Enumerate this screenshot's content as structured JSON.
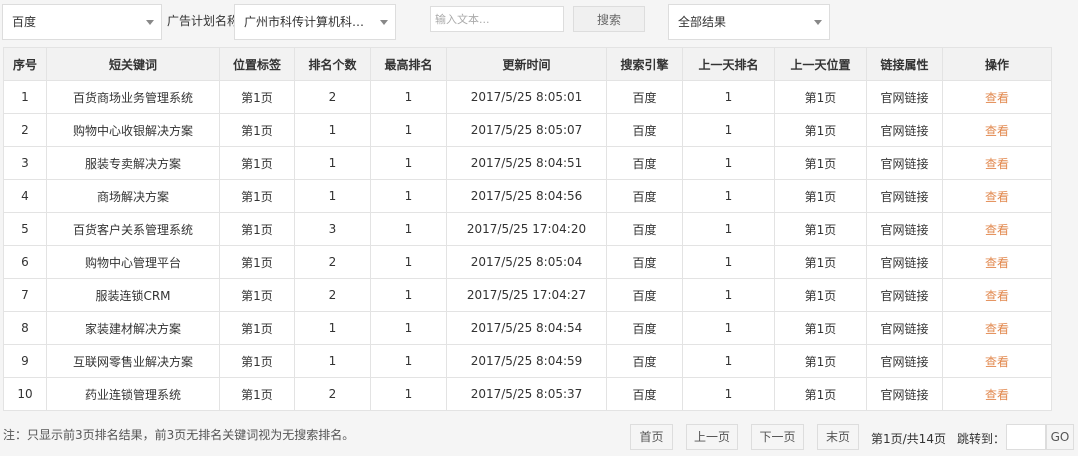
{
  "toolbar": {
    "engine_select": {
      "value": "百度"
    },
    "plan_label": "广告计划名称",
    "plan_select": {
      "value": "广州市科传计算机科技..."
    },
    "keyword_input": {
      "placeholder": "输入文本..."
    },
    "search_label": "搜索",
    "result_select": {
      "value": "全部结果"
    }
  },
  "table": {
    "headers": [
      "序号",
      "短关键词",
      "位置标签",
      "排名个数",
      "最高排名",
      "更新时间",
      "搜索引擎",
      "上一天排名",
      "上一天位置",
      "链接属性",
      "操作"
    ],
    "rows": [
      [
        "1",
        "百货商场业务管理系统",
        "第1页",
        "2",
        "1",
        "2017/5/25 8:05:01",
        "百度",
        "1",
        "第1页",
        "官网链接",
        "查看"
      ],
      [
        "2",
        "购物中心收银解决方案",
        "第1页",
        "1",
        "1",
        "2017/5/25 8:05:07",
        "百度",
        "1",
        "第1页",
        "官网链接",
        "查看"
      ],
      [
        "3",
        "服装专卖解决方案",
        "第1页",
        "1",
        "1",
        "2017/5/25 8:04:51",
        "百度",
        "1",
        "第1页",
        "官网链接",
        "查看"
      ],
      [
        "4",
        "商场解决方案",
        "第1页",
        "1",
        "1",
        "2017/5/25 8:04:56",
        "百度",
        "1",
        "第1页",
        "官网链接",
        "查看"
      ],
      [
        "5",
        "百货客户关系管理系统",
        "第1页",
        "3",
        "1",
        "2017/5/25 17:04:20",
        "百度",
        "1",
        "第1页",
        "官网链接",
        "查看"
      ],
      [
        "6",
        "购物中心管理平台",
        "第1页",
        "2",
        "1",
        "2017/5/25 8:05:04",
        "百度",
        "1",
        "第1页",
        "官网链接",
        "查看"
      ],
      [
        "7",
        "服装连锁CRM",
        "第1页",
        "2",
        "1",
        "2017/5/25 17:04:27",
        "百度",
        "1",
        "第1页",
        "官网链接",
        "查看"
      ],
      [
        "8",
        "家装建材解决方案",
        "第1页",
        "1",
        "1",
        "2017/5/25 8:04:54",
        "百度",
        "1",
        "第1页",
        "官网链接",
        "查看"
      ],
      [
        "9",
        "互联网零售业解决方案",
        "第1页",
        "1",
        "1",
        "2017/5/25 8:04:59",
        "百度",
        "1",
        "第1页",
        "官网链接",
        "查看"
      ],
      [
        "10",
        "药业连锁管理系统",
        "第1页",
        "2",
        "1",
        "2017/5/25 8:05:37",
        "百度",
        "1",
        "第1页",
        "官网链接",
        "查看"
      ]
    ]
  },
  "footer": {
    "note": "注：只显示前3页排名结果，前3页无排名关键词视为无搜索排名。",
    "first_label": "首页",
    "prev_label": "上一页",
    "next_label": "下一页",
    "last_label": "末页",
    "page_info": "第1页/共14页",
    "jump_label": "跳转到：",
    "go_label": "GO"
  },
  "colors": {
    "action_link": "#e2884e",
    "header_bg": "#f2f2f2",
    "page_bg": "#f5f5f5",
    "border": "#e3e3e3"
  },
  "icons": {
    "select_caret": "caret-down-icon"
  }
}
